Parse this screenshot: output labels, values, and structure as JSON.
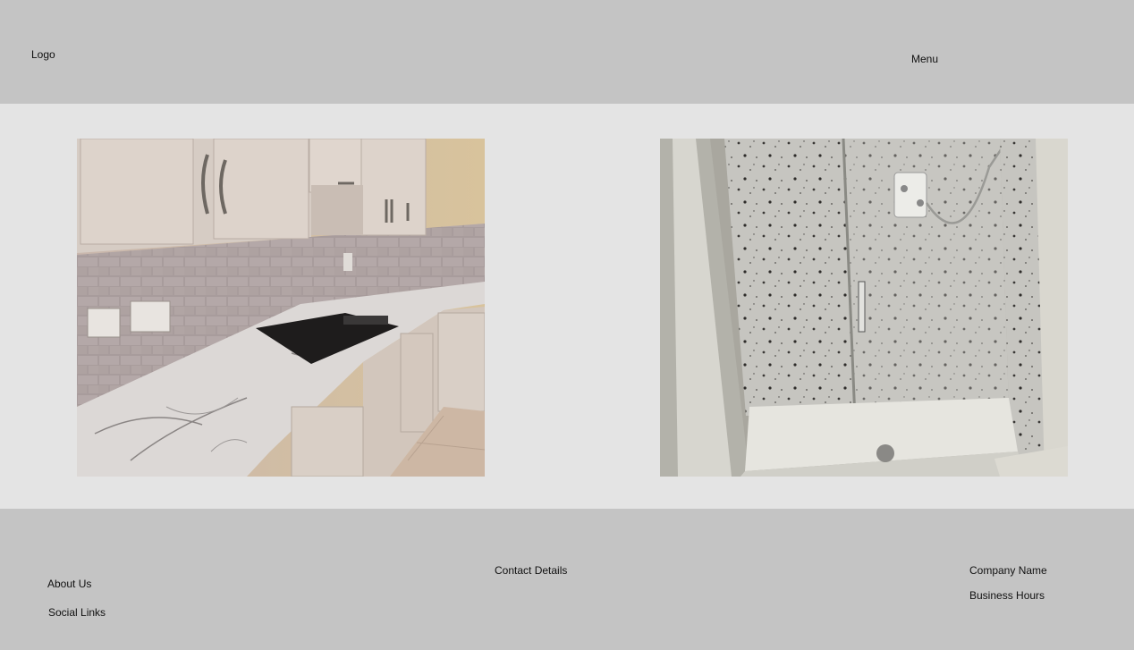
{
  "header": {
    "logo": "Logo",
    "menu": "Menu"
  },
  "gallery": {
    "images": [
      {
        "subject": "kitchen with marble worktop, grey tiles and cream cabinets"
      },
      {
        "subject": "shower enclosure with speckled wall panels and glass door"
      }
    ]
  },
  "footer": {
    "about": "About Us",
    "social": "Social Links",
    "contact": "Contact Details",
    "company": "Company Name",
    "hours": "Business Hours"
  },
  "colors": {
    "header_footer_bg": "#c4c4c4",
    "body_bg": "#e4e4e4"
  }
}
